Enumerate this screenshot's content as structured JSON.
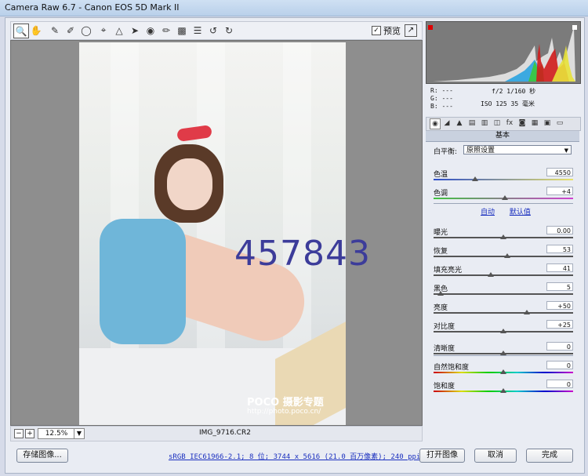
{
  "window": {
    "title": "Camera Raw 6.7 -  Canon EOS 5D Mark II"
  },
  "toolbar": {
    "tools": [
      "zoom-icon",
      "hand-icon",
      "white-balance-icon",
      "color-sampler-icon",
      "target-adjust-icon",
      "crop-icon",
      "straighten-icon",
      "spot-removal-icon",
      "red-eye-icon",
      "adjustment-brush-icon",
      "graduated-filter-icon",
      "preferences-icon",
      "rotate-left-icon",
      "rotate-right-icon"
    ],
    "preview_label": "预览",
    "preview_checked": "✓"
  },
  "image": {
    "watermark": "457843",
    "poco": "POCO 摄影专题",
    "poco_url": "http://photo.poco.cn/"
  },
  "statusbar": {
    "zoom": "12.5%",
    "filename": "IMG_9716.CR2"
  },
  "bottom": {
    "save_label": "存储图像...",
    "workflow_info": "sRGB IEC61966-2.1; 8 位; 3744 x 5616 (21.0 百万像素); 240 ppi",
    "open_label": "打开图像",
    "cancel_label": "取消",
    "done_label": "完成"
  },
  "readout": {
    "r": "R:  ---",
    "g": "G:  ---",
    "b": "B:  ---",
    "aperture_shutter": "f/2   1/160 秒",
    "iso_focal": "ISO 125   35 毫米"
  },
  "panel": {
    "header": "基本",
    "wb_label": "白平衡:",
    "wb_value": "原照设置",
    "auto_link": "自动",
    "default_link": "默认值",
    "sliders": [
      {
        "label": "色温",
        "value": "4550",
        "pos": 0.3
      },
      {
        "label": "色调",
        "value": "+4",
        "pos": 0.51
      },
      {
        "label": "曝光",
        "value": "0.00",
        "pos": 0.5
      },
      {
        "label": "恢复",
        "value": "53",
        "pos": 0.53
      },
      {
        "label": "填充亮光",
        "value": "41",
        "pos": 0.41
      },
      {
        "label": "黑色",
        "value": "5",
        "pos": 0.05
      },
      {
        "label": "亮度",
        "value": "+50",
        "pos": 0.67
      },
      {
        "label": "对比度",
        "value": "+25",
        "pos": 0.5
      },
      {
        "label": "清晰度",
        "value": "0",
        "pos": 0.5
      },
      {
        "label": "自然饱和度",
        "value": "0",
        "pos": 0.5
      },
      {
        "label": "饱和度",
        "value": "0",
        "pos": 0.5
      }
    ]
  },
  "colors": {
    "accent": "#1a2fbf",
    "watermark": "#3c3c9a",
    "bow": "#e03b48"
  }
}
